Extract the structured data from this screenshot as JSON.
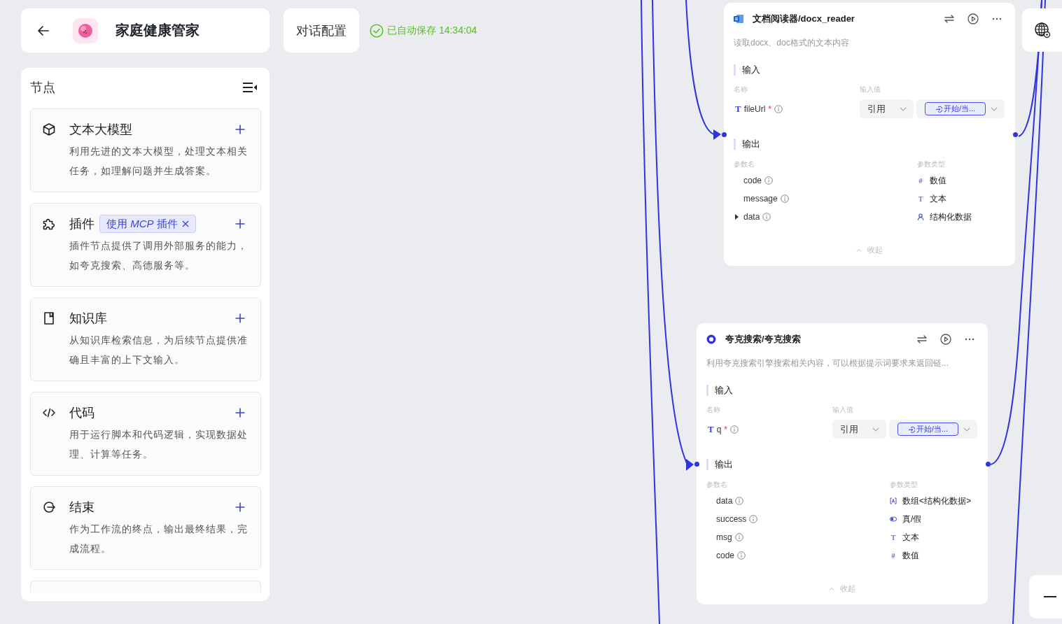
{
  "header": {
    "title": "家庭健康管家",
    "config_button": "对话配置",
    "save_status": "已自动保存 14:34:04"
  },
  "node_panel": {
    "title": "节点",
    "items": [
      {
        "kind": "llm",
        "title": "文本大模型",
        "description": "利用先进的文本大模型，处理文本相关任务，如理解问题并生成答案。"
      },
      {
        "kind": "plugin",
        "title": "插件",
        "tag": "使用 *MCP* 插件",
        "description": "插件节点提供了调用外部服务的能力，如夸克搜索、高德服务等。"
      },
      {
        "kind": "knowledge",
        "title": "知识库",
        "description": "从知识库检索信息，为后续节点提供准确且丰富的上下文输入。"
      },
      {
        "kind": "code",
        "title": "代码",
        "description": "用于运行脚本和代码逻辑，实现数据处理、计算等任务。"
      },
      {
        "kind": "end",
        "title": "结束",
        "description": "作为工作流的终点，输出最终结果，完成流程。"
      }
    ]
  },
  "canvas": {
    "nodes": [
      {
        "kind": "document",
        "title": "文档阅读器/docx_reader",
        "description": "读取docx、doc格式的文本内容",
        "input_label": "输入",
        "input_columns": [
          "名称",
          "输入值"
        ],
        "inputs": [
          {
            "glyph": "T",
            "name": "fileUrl",
            "required_mark": "*",
            "mode": "引用",
            "value": "开始/当..."
          }
        ],
        "output_label": "输出",
        "output_columns": [
          "参数名",
          "参数类型"
        ],
        "outputs": [
          {
            "name": "code",
            "kind": "number",
            "glyph": "#",
            "type": "数值",
            "expandable": false
          },
          {
            "name": "message",
            "kind": "text",
            "glyph": "T",
            "type": "文本",
            "expandable": false
          },
          {
            "name": "data",
            "kind": "object",
            "type": "结构化数据",
            "expandable": true
          }
        ],
        "collapse": "收起"
      },
      {
        "kind": "search",
        "title": "夸克搜索/夸克搜索",
        "description": "利用夸克搜索引擎搜索相关内容，可以根据提示词要求来返回链...",
        "input_label": "输入",
        "input_columns": [
          "名称",
          "输入值"
        ],
        "inputs": [
          {
            "glyph": "T",
            "name": "q",
            "required_mark": "*",
            "mode": "引用",
            "value": "开始/当..."
          }
        ],
        "output_label": "输出",
        "output_columns": [
          "参数名",
          "参数类型"
        ],
        "outputs": [
          {
            "name": "data",
            "kind": "array",
            "type": "数组<结构化数据>",
            "expandable": false
          },
          {
            "name": "success",
            "kind": "boolean",
            "type": "真/假",
            "expandable": false
          },
          {
            "name": "msg",
            "kind": "text",
            "glyph": "T",
            "type": "文本",
            "expandable": false
          },
          {
            "name": "code",
            "kind": "number",
            "glyph": "#",
            "type": "数值",
            "expandable": false
          }
        ],
        "collapse": "收起"
      }
    ]
  }
}
